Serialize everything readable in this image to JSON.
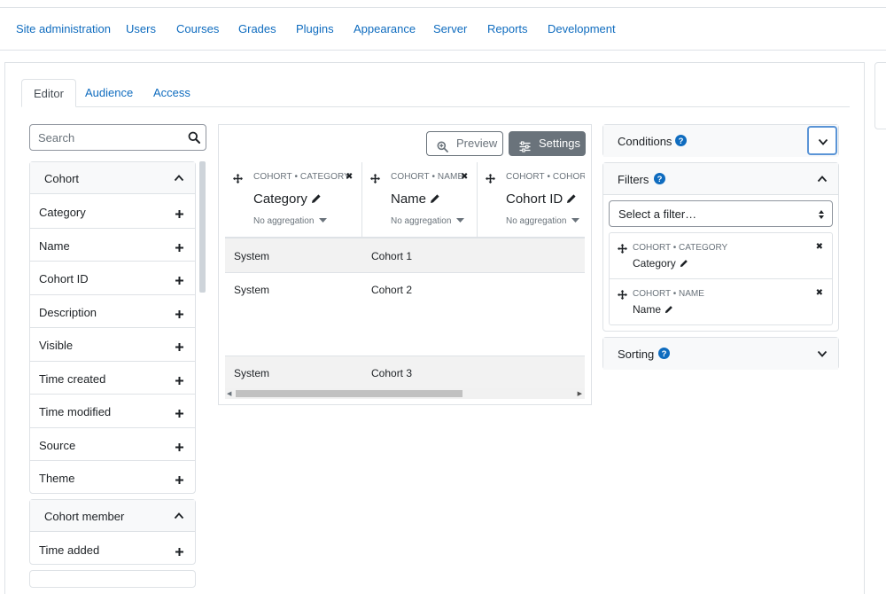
{
  "admin_nav": {
    "items": [
      {
        "label": "Site administration"
      },
      {
        "label": "Users"
      },
      {
        "label": "Courses"
      },
      {
        "label": "Grades"
      },
      {
        "label": "Plugins"
      },
      {
        "label": "Appearance"
      },
      {
        "label": "Server"
      },
      {
        "label": "Reports"
      },
      {
        "label": "Development"
      }
    ]
  },
  "tabs": [
    {
      "label": "Editor",
      "active": true
    },
    {
      "label": "Audience",
      "active": false
    },
    {
      "label": "Access",
      "active": false
    }
  ],
  "sidebar": {
    "search_placeholder": "Search",
    "groups": [
      {
        "title": "Cohort",
        "items": [
          "Category",
          "Name",
          "Cohort ID",
          "Description",
          "Visible",
          "Time created",
          "Time modified",
          "Source",
          "Theme"
        ]
      },
      {
        "title": "Cohort member",
        "items": [
          "Time added"
        ]
      }
    ]
  },
  "toolbar": {
    "preview_label": "Preview",
    "settings_label": "Settings"
  },
  "report": {
    "columns": [
      {
        "identifier": "COHORT • CATEGORY",
        "title": "Category",
        "aggregation": "No aggregation"
      },
      {
        "identifier": "COHORT • NAME",
        "title": "Name",
        "aggregation": "No aggregation"
      },
      {
        "identifier": "COHORT • COHORT",
        "title": "Cohort ID",
        "aggregation": "No aggregation"
      }
    ],
    "rows": [
      {
        "category": "System",
        "name": "Cohort 1"
      },
      {
        "category": "System",
        "name": "Cohort 2"
      },
      {
        "category": "System",
        "name": "Cohort 3"
      }
    ]
  },
  "right_panel": {
    "conditions": {
      "title": "Conditions"
    },
    "filters": {
      "title": "Filters",
      "select_placeholder": "Select a filter…",
      "items": [
        {
          "identifier": "COHORT • CATEGORY",
          "name": "Category"
        },
        {
          "identifier": "COHORT • NAME",
          "name": "Name"
        }
      ]
    },
    "sorting": {
      "title": "Sorting"
    }
  },
  "colors": {
    "link": "#0f6cbf",
    "help_icon": "#0f6cbf",
    "secondary_button": "#6a737b",
    "focus_ring": "#5a94d6"
  }
}
